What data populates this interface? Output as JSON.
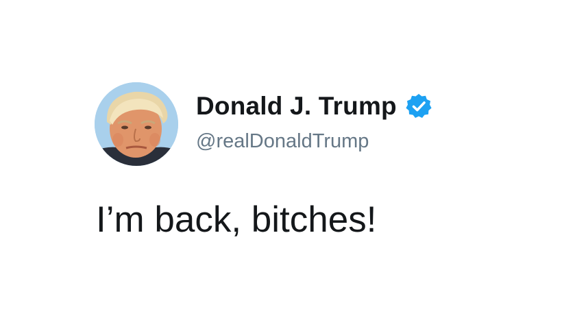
{
  "tweet": {
    "author": {
      "display_name": "Donald J. Trump",
      "handle": "@realDonaldTrump",
      "verified": true,
      "verified_badge_icon": "verified-badge-icon",
      "avatar_icon": "profile-photo"
    },
    "text": "I’m back, bitches!"
  },
  "colors": {
    "name": "#14171a",
    "handle": "#657786",
    "verified_blue": "#1da1f2",
    "background": "#ffffff"
  }
}
